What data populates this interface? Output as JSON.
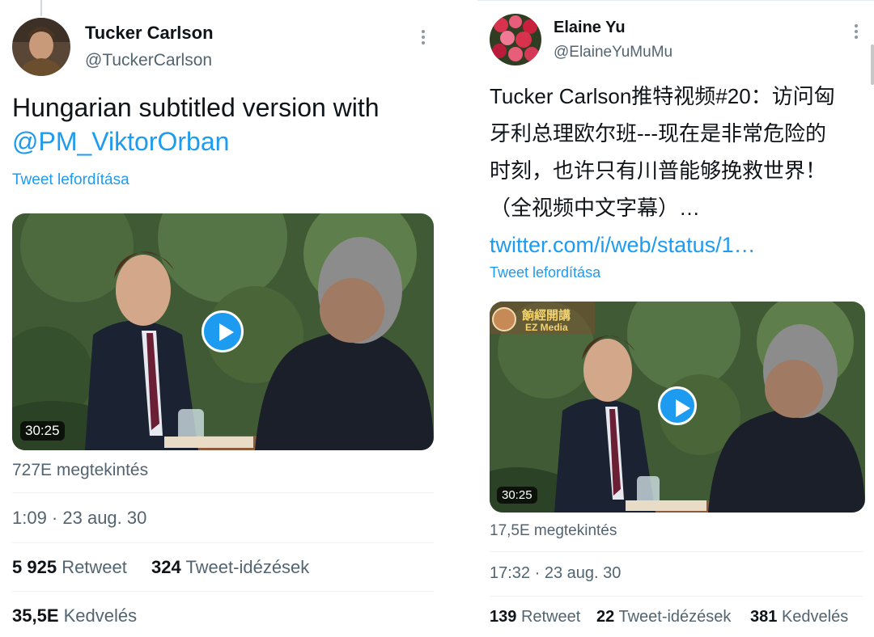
{
  "left": {
    "author": {
      "name": "Tucker Carlson",
      "handle": "@TuckerCarlson"
    },
    "text": "Hungarian subtitled version with",
    "mention": "@PM_ViktorOrban",
    "translate": "Tweet lefordítása",
    "video": {
      "duration": "30:25"
    },
    "views": "727E megtekintés",
    "timestamp": "1:09 · 23 aug. 30",
    "stats": {
      "retweets_count": "5 925",
      "retweets_label": "Retweet",
      "quotes_count": "324",
      "quotes_label": "Tweet-idézések",
      "likes_count": "35,5E",
      "likes_label": "Kedvelés"
    }
  },
  "right": {
    "author": {
      "name": "Elaine Yu",
      "handle": "@ElaineYuMuMu"
    },
    "text": "Tucker Carlson推特视频#20：访问匈牙利总理欧尔班---现在是非常危险的时刻，也许只有川普能够挽救世界！（全视频中文字幕）…",
    "link": "twitter.com/i/web/status/1…",
    "translate": "Tweet lefordítása",
    "video": {
      "duration": "30:25",
      "watermark_cn": "餉經開講",
      "watermark_en": "EZ Media"
    },
    "views": "17,5E megtekintés",
    "timestamp": "17:32 · 23 aug. 30",
    "stats": {
      "retweets_count": "139",
      "retweets_label": "Retweet",
      "quotes_count": "22",
      "quotes_label": "Tweet-idézések",
      "likes_count": "381",
      "likes_label": "Kedvelés"
    }
  },
  "icons": {
    "more": "more-icon",
    "play": "play-icon"
  },
  "colors": {
    "accent": "#1d9bf0",
    "secondary_text": "#536471",
    "divider": "#eff3f4"
  }
}
